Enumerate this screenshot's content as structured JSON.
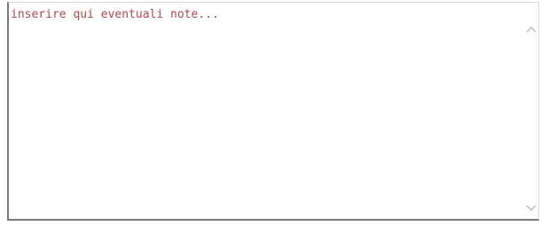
{
  "notes": {
    "placeholder": "inserire qui eventuali note...",
    "value": ""
  },
  "scrollbar": {
    "up_icon": "chevron-up-icon",
    "down_icon": "chevron-down-icon",
    "arrow_color": "#b5b5b5"
  }
}
